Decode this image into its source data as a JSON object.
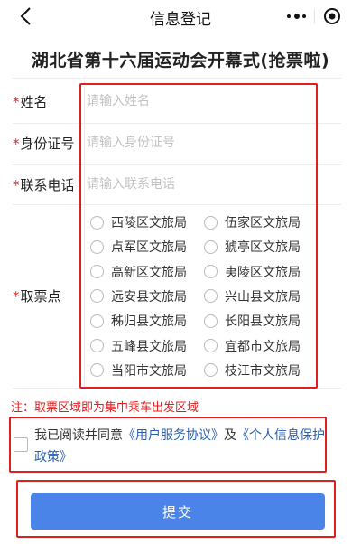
{
  "nav": {
    "title": "信息登记",
    "back_icon": "chevron-left-icon",
    "more_icon": "more-dots-icon",
    "close_icon": "target-close-icon"
  },
  "page_title": "湖北省第十六届运动会开幕式(抢票啦)",
  "form": {
    "required_mark": "*",
    "name": {
      "label": "姓名",
      "value": "",
      "placeholder": "请输入姓名"
    },
    "id_number": {
      "label": "身份证号",
      "value": "",
      "placeholder": "请输入身份证号"
    },
    "phone": {
      "label": "联系电话",
      "value": "",
      "placeholder": "请输入联系电话"
    },
    "pickup": {
      "label": "取票点",
      "options": [
        {
          "label": "西陵区文旅局",
          "selected": false
        },
        {
          "label": "伍家区文旅局",
          "selected": false
        },
        {
          "label": "点军区文旅局",
          "selected": false
        },
        {
          "label": "猇亭区文旅局",
          "selected": false
        },
        {
          "label": "高新区文旅局",
          "selected": false
        },
        {
          "label": "夷陵区文旅局",
          "selected": false
        },
        {
          "label": "远安县文旅局",
          "selected": false
        },
        {
          "label": "兴山县文旅局",
          "selected": false
        },
        {
          "label": "秭归县文旅局",
          "selected": false
        },
        {
          "label": "长阳县文旅局",
          "selected": false
        },
        {
          "label": "五峰县文旅局",
          "selected": false
        },
        {
          "label": "宜都市文旅局",
          "selected": false
        },
        {
          "label": "当阳市文旅局",
          "selected": false
        },
        {
          "label": "枝江市文旅局",
          "selected": false
        }
      ]
    }
  },
  "notice": "注：取票区域即为集中乘车出发区域",
  "agreement": {
    "checked": false,
    "prefix": "我已阅读并同意",
    "link1": "《用户服务协议》",
    "middle": "及",
    "link2": "《个人信息保护政策》"
  },
  "submit_label": "提交",
  "colors": {
    "highlight_box": "#e02020",
    "notice_text": "#e02020",
    "link": "#2a5fb0",
    "submit_button": "#4a84e9"
  }
}
